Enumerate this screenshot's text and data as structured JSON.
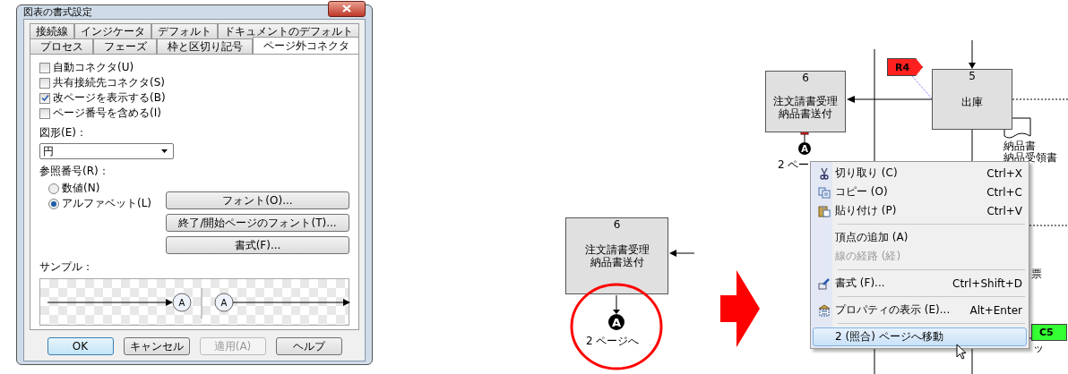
{
  "dialog": {
    "title": "図表の書式設定",
    "tabs_row1": [
      {
        "label": "接続線",
        "selected": false
      },
      {
        "label": "インジケータ",
        "selected": false
      },
      {
        "label": "デフォルト",
        "selected": false
      },
      {
        "label": "ドキュメントのデフォルト",
        "selected": false
      }
    ],
    "tabs_row2": [
      {
        "label": "プロセス",
        "selected": false
      },
      {
        "label": "フェーズ",
        "selected": false
      },
      {
        "label": "枠と区切り記号",
        "selected": false
      },
      {
        "label": "ページ外コネクタ",
        "selected": true
      }
    ],
    "checkboxes": [
      {
        "label": "自動コネクタ(U)",
        "checked": false
      },
      {
        "label": "共有接続先コネクタ(S)",
        "checked": false
      },
      {
        "label": "改ページを表示する(B)",
        "checked": true
      },
      {
        "label": "ページ番号を含める(I)",
        "checked": false
      }
    ],
    "shape_label": "図形(E)：",
    "shape_value": "円",
    "ref_label": "参照番号(R)：",
    "radios": [
      {
        "label": "数値(N)",
        "selected": false
      },
      {
        "label": "アルファベット(L)",
        "selected": true
      }
    ],
    "side_buttons": [
      "フォント(O)...",
      "終了/開始ページのフォント(T)...",
      "書式(F)..."
    ],
    "sample_label": "サンプル：",
    "sample": {
      "start_marker": "A",
      "end_marker": "A"
    },
    "buttons": [
      {
        "label": "OK",
        "default": true,
        "disabled": false
      },
      {
        "label": "キャンセル",
        "default": false,
        "disabled": false
      },
      {
        "label": "適用(A)",
        "default": false,
        "disabled": true
      },
      {
        "label": "ヘルプ",
        "default": false,
        "disabled": false
      }
    ]
  },
  "before": {
    "process": {
      "number": "6",
      "lines": [
        "注文請書受理",
        "納品書送付"
      ]
    },
    "connector": {
      "letter": "A",
      "label": "2 ページへ"
    }
  },
  "after": {
    "process_left": {
      "number": "6",
      "lines": [
        "注文請書受理",
        "納品書送付"
      ]
    },
    "connector": {
      "letter": "A",
      "label": "2 ペー"
    },
    "process_right": {
      "number": "5",
      "lines": [
        "出庫"
      ]
    },
    "tags": [
      {
        "text": "R4",
        "color": "#ff2020"
      },
      {
        "text": "C5",
        "color": "#33ff33"
      }
    ],
    "document_labels": [
      "納品書",
      "納品受領書"
    ],
    "fragments": [
      "票",
      "ッ"
    ]
  },
  "context_menu": {
    "items": [
      {
        "kind": "item",
        "label": "切り取り (C)",
        "shortcut": "Ctrl+X",
        "icon": true,
        "disabled": false,
        "selected": false
      },
      {
        "kind": "item",
        "label": "コピー (O)",
        "shortcut": "Ctrl+C",
        "icon": true,
        "disabled": false,
        "selected": false
      },
      {
        "kind": "item",
        "label": "貼り付け (P)",
        "shortcut": "Ctrl+V",
        "icon": true,
        "disabled": false,
        "selected": false
      },
      {
        "kind": "separator"
      },
      {
        "kind": "item",
        "label": "頂点の追加 (A)",
        "icon": false,
        "disabled": false,
        "selected": false
      },
      {
        "kind": "item",
        "label": "線の経路 (経)",
        "icon": false,
        "disabled": true,
        "selected": false
      },
      {
        "kind": "separator"
      },
      {
        "kind": "item",
        "label": "書式 (F)...",
        "shortcut": "Ctrl+Shift+D",
        "icon": true,
        "disabled": false,
        "selected": false
      },
      {
        "kind": "separator"
      },
      {
        "kind": "item",
        "label": "プロパティの表示 (E)...",
        "shortcut": "Alt+Enter",
        "icon": true,
        "disabled": false,
        "selected": false
      },
      {
        "kind": "separator"
      },
      {
        "kind": "item",
        "label": "2 (照合) ページへ移動",
        "icon": false,
        "disabled": false,
        "selected": true
      }
    ]
  }
}
